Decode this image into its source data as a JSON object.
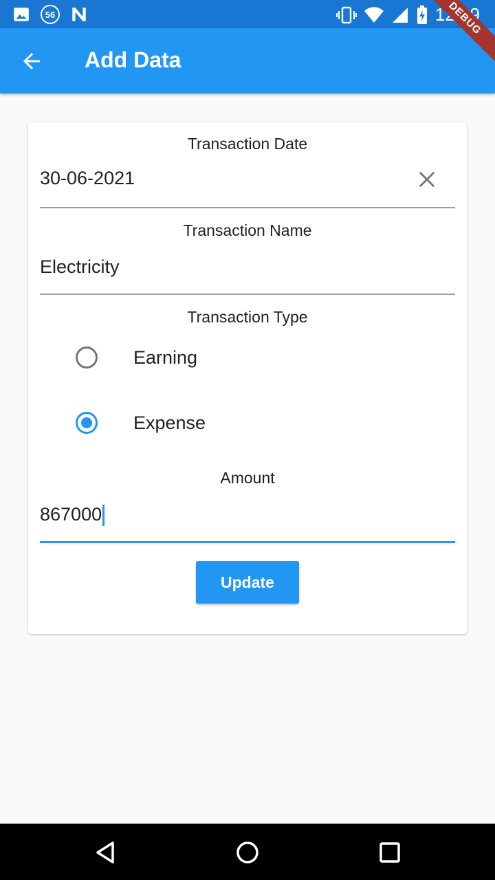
{
  "status_bar": {
    "time": "12:29",
    "left_icons": [
      "image-icon",
      "badge-56-icon",
      "n-logo-icon"
    ],
    "badge_text": "56",
    "right_icons": [
      "vibrate-icon",
      "wifi-icon",
      "signal-icon",
      "battery-charging-icon"
    ]
  },
  "debug_banner": "DEBUG",
  "app_bar": {
    "title": "Add Data",
    "back_icon": "arrow-back-icon"
  },
  "form": {
    "date": {
      "label": "Transaction Date",
      "value": "30-06-2021",
      "clear_icon": "close-icon"
    },
    "name": {
      "label": "Transaction Name",
      "value": "Electricity"
    },
    "type": {
      "label": "Transaction Type",
      "options": [
        {
          "label": "Earning",
          "selected": false
        },
        {
          "label": "Expense",
          "selected": true
        }
      ]
    },
    "amount": {
      "label": "Amount",
      "value": "867000"
    },
    "submit_label": "Update"
  },
  "nav_bar": {
    "buttons": [
      "back-triangle-icon",
      "home-circle-icon",
      "recents-square-icon"
    ]
  },
  "colors": {
    "primary": "#2196f3",
    "status_bar": "#1976d2",
    "debug": "#a5342e"
  }
}
